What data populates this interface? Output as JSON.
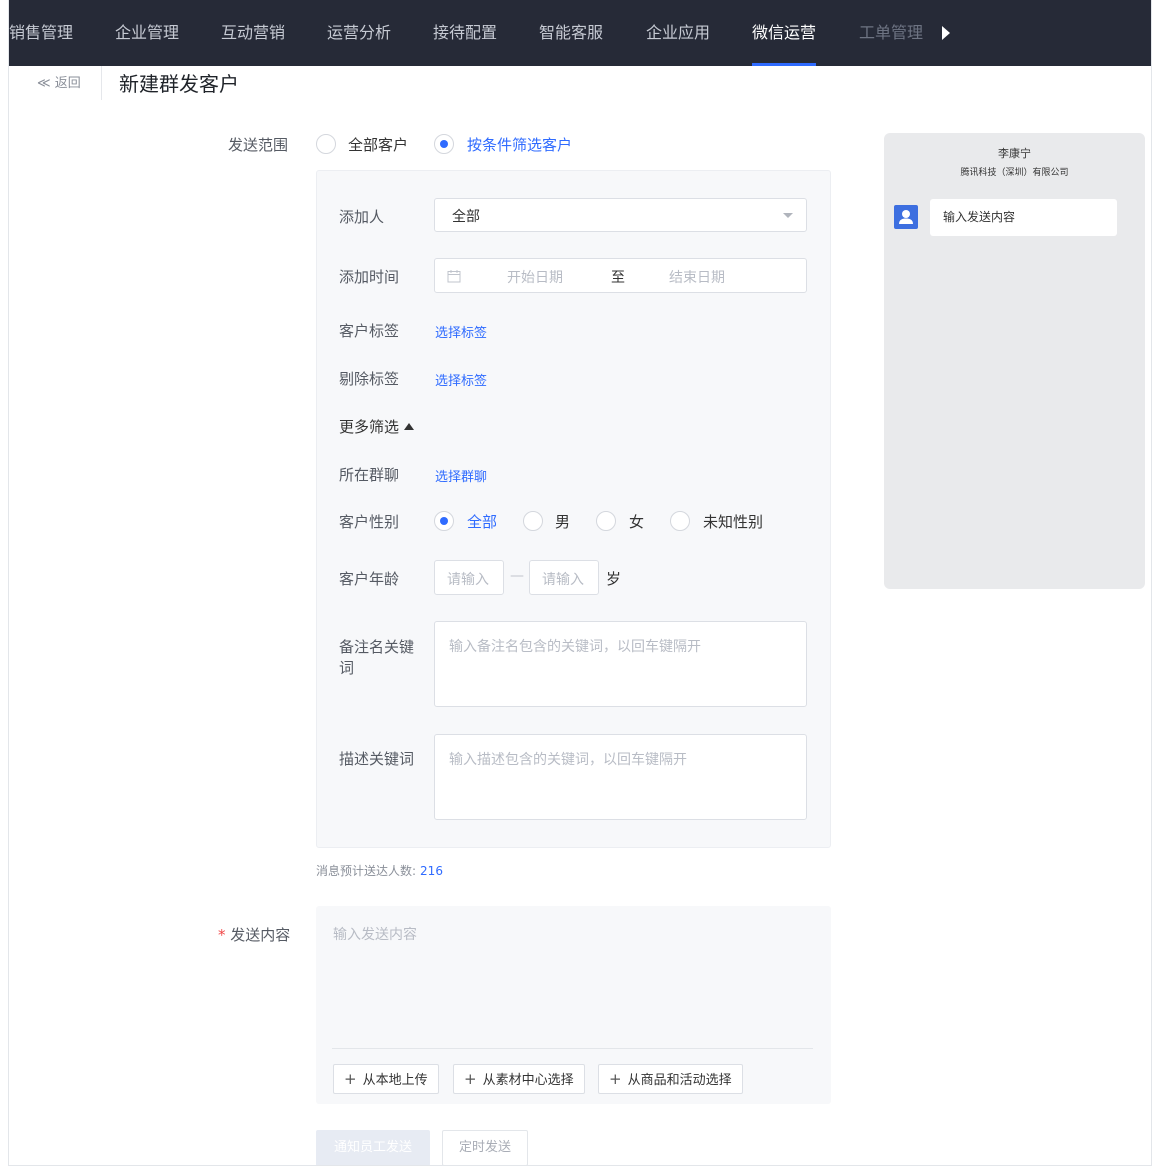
{
  "nav": {
    "items": [
      "销售管理",
      "企业管理",
      "互动营销",
      "运营分析",
      "接待配置",
      "智能客服",
      "企业应用",
      "微信运营",
      "工单管理"
    ]
  },
  "header": {
    "back": "≪ 返回",
    "title": "新建群发客户"
  },
  "scope": {
    "label": "发送范围",
    "options": [
      "全部客户",
      "按条件筛选客户"
    ],
    "selected": "按条件筛选客户"
  },
  "filters": {
    "adder_label": "添加人",
    "adder_value": "全部",
    "time_label": "添加时间",
    "time_start_placeholder": "开始日期",
    "time_to": "至",
    "time_end_placeholder": "结束日期",
    "tag_label": "客户标签",
    "tag_link": "选择标签",
    "exclude_label": "剔除标签",
    "exclude_link": "选择标签",
    "more_label": "更多筛选",
    "group_label": "所在群聊",
    "group_link": "选择群聊",
    "gender_label": "客户性别",
    "gender_options": [
      "全部",
      "男",
      "女",
      "未知性别"
    ],
    "gender_selected": "全部",
    "age_label": "客户年龄",
    "age_min_placeholder": "请输入",
    "age_dash": "—",
    "age_max_placeholder": "请输入",
    "age_unit": "岁",
    "remark_label_1": "备注名关键",
    "remark_label_2": "词",
    "remark_placeholder": "输入备注名包含的关键词，以回车键隔开",
    "desc_label": "描述关键词",
    "desc_placeholder": "输入描述包含的关键词，以回车键隔开"
  },
  "estimate": {
    "label": "消息预计送达人数:",
    "count": "216"
  },
  "content": {
    "required_mark": "*",
    "label": "发送内容",
    "placeholder": "输入发送内容",
    "buttons": [
      "从本地上传",
      "从素材中心选择",
      "从商品和活动选择"
    ]
  },
  "actions": {
    "notify": "通知员工发送",
    "schedule": "定时发送"
  },
  "preview": {
    "name": "李康宁",
    "company": "腾讯科技（深圳）有限公司",
    "message": "输入发送内容"
  },
  "colors": {
    "nav_bg": "#262a37",
    "accent": "#2f6bff",
    "panel_bg": "#f7f8fa",
    "preview_bg": "#e9eaec"
  }
}
